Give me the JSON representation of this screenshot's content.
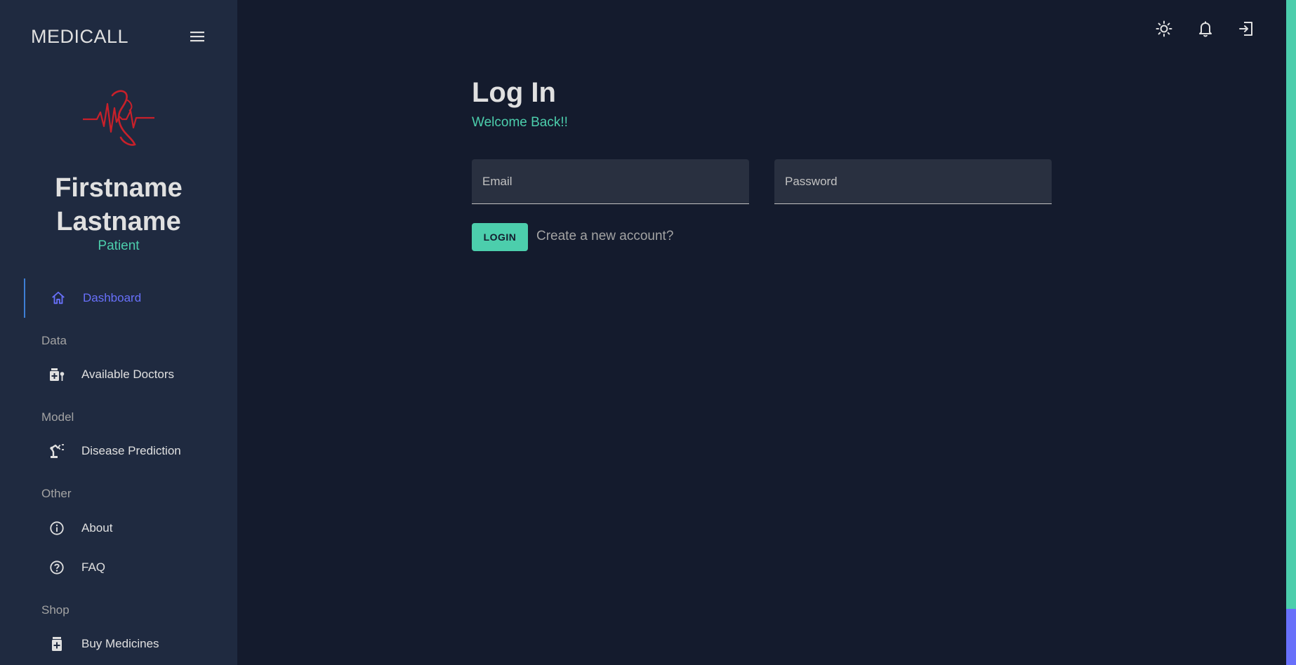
{
  "sidebar": {
    "brand": "MEDICALL",
    "user": {
      "name": "Firstname Lastname",
      "role": "Patient"
    },
    "items": [
      {
        "label": "Dashboard",
        "icon": "home-icon",
        "active": true
      },
      {
        "section": "Data"
      },
      {
        "label": "Available Doctors",
        "icon": "medical-services-icon"
      },
      {
        "section": "Model"
      },
      {
        "label": "Disease Prediction",
        "icon": "precision-manufacturing-icon"
      },
      {
        "section": "Other"
      },
      {
        "label": "About",
        "icon": "info-icon"
      },
      {
        "label": "FAQ",
        "icon": "help-icon"
      },
      {
        "section": "Shop"
      },
      {
        "label": "Buy Medicines",
        "icon": "medication-icon"
      }
    ]
  },
  "topbar": {
    "icons": [
      "light-mode-icon",
      "notifications-icon",
      "logout-icon"
    ]
  },
  "login": {
    "title": "Log In",
    "subtitle": "Welcome Back!!",
    "email_placeholder": "Email",
    "password_placeholder": "Password",
    "button_label": "LOGIN",
    "create_account": "Create a new account?"
  },
  "colors": {
    "background": "#141b2d",
    "sidebar": "#1f2a40",
    "accent_green": "#4cceac",
    "accent_blue": "#6870fa"
  }
}
